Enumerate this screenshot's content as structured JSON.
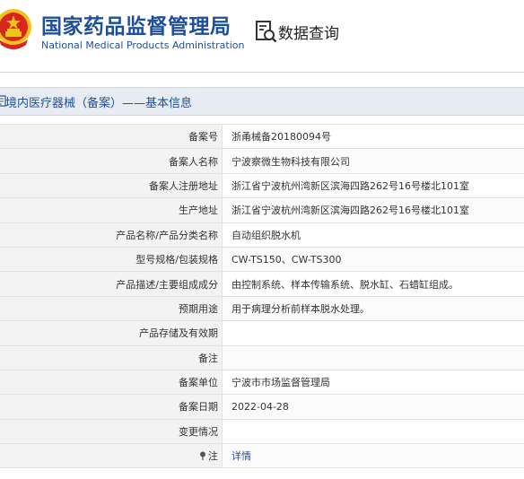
{
  "header": {
    "title_cn": "国家药品监督管理局",
    "title_en": "National Medical Products Administration",
    "search_label": "数据查询"
  },
  "section": {
    "title": "境内医疗器械（备案）——基本信息"
  },
  "rows": [
    {
      "label": "备案号",
      "value": "浙甬械备20180094号"
    },
    {
      "label": "备案人名称",
      "value": "宁波察微生物科技有限公司"
    },
    {
      "label": "备案人注册地址",
      "value": "浙江省宁波杭州湾新区滨海四路262号16号楼北101室"
    },
    {
      "label": "生产地址",
      "value": "浙江省宁波杭州湾新区滨海四路262号16号楼北101室"
    },
    {
      "label": "产品名称/产品分类名称",
      "value": "自动组织脱水机"
    },
    {
      "label": "型号规格/包装规格",
      "value": "CW-TS150、CW-TS300"
    },
    {
      "label": "产品描述/主要组成成分",
      "value": "由控制系统、样本传输系统、脱水缸、石蜡缸组成。"
    },
    {
      "label": "预期用途",
      "value": "用于病理分析前样本脱水处理。"
    },
    {
      "label": "产品存储及有效期",
      "value": ""
    },
    {
      "label": "备注",
      "value": ""
    },
    {
      "label": "备案单位",
      "value": "宁波市市场监督管理局"
    },
    {
      "label": "备案日期",
      "value": "2022-04-28"
    },
    {
      "label": "变更情况",
      "value": ""
    },
    {
      "label": "注",
      "value": "详情"
    }
  ],
  "icons": {
    "emblem": "national-emblem-icon",
    "search": "search-document-icon",
    "section": "document-icon",
    "note": "pin-icon"
  },
  "colors": {
    "brand": "#1e4f9c",
    "emblem_red": "#d7261b",
    "emblem_gold": "#f2c21b",
    "section_bg": "#e6ecf2",
    "label_bg": "#f3f3f3"
  }
}
